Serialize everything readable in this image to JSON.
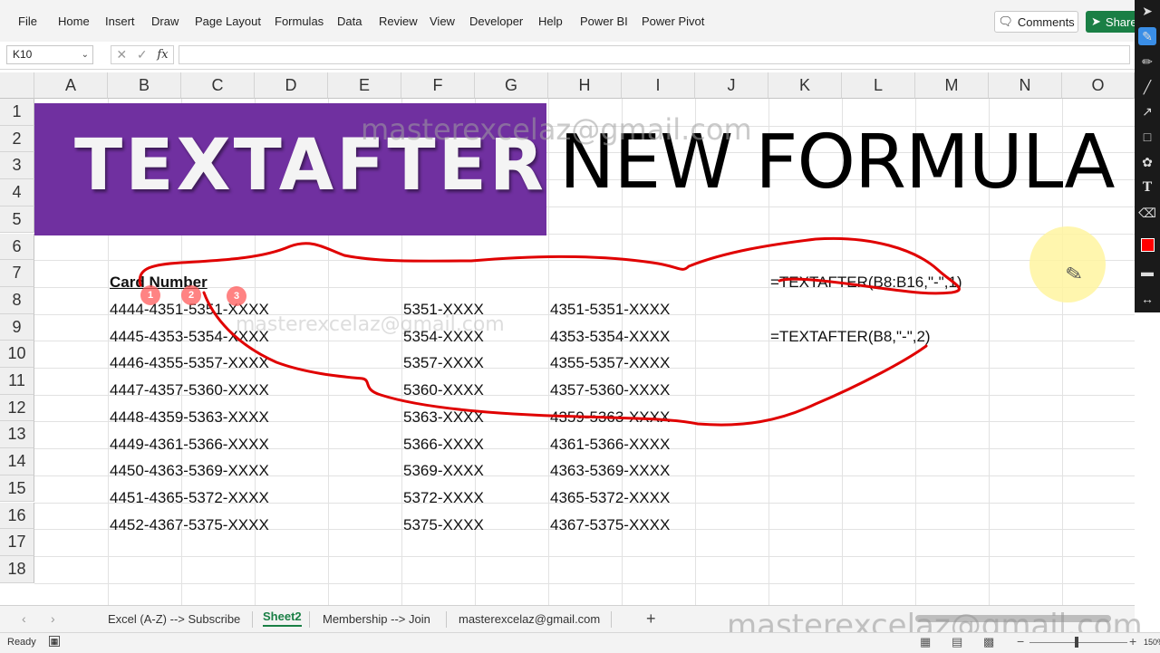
{
  "ribbon": {
    "menus": [
      "File",
      "Home",
      "Insert",
      "Draw",
      "Page Layout",
      "Formulas",
      "Data",
      "Review",
      "View",
      "Developer",
      "Help",
      "Power BI",
      "Power Pivot"
    ],
    "comments_label": "Comments",
    "share_label": "Share"
  },
  "formula_bar": {
    "name_box": "K10",
    "fx_label": "fx",
    "formula": ""
  },
  "grid": {
    "columns": [
      "A",
      "B",
      "C",
      "D",
      "E",
      "F",
      "G",
      "H",
      "I",
      "J",
      "K",
      "L",
      "M",
      "N",
      "O"
    ],
    "rows": [
      "1",
      "2",
      "3",
      "4",
      "5",
      "6",
      "7",
      "8",
      "9",
      "10",
      "11",
      "12",
      "13",
      "14",
      "15",
      "16",
      "17",
      "18"
    ],
    "banner_text": "TEXTAFTER",
    "big_text": "NEW FORMULA",
    "header": "Card Number",
    "card_numbers": [
      "4444-4351-5351-XXXX",
      "4445-4353-5354-XXXX",
      "4446-4355-5357-XXXX",
      "4447-4357-5360-XXXX",
      "4448-4359-5363-XXXX",
      "4449-4361-5366-XXXX",
      "4450-4363-5369-XXXX",
      "4451-4365-5372-XXXX",
      "4452-4367-5375-XXXX"
    ],
    "col_f": [
      "5351-XXXX",
      "5354-XXXX",
      "5357-XXXX",
      "5360-XXXX",
      "5363-XXXX",
      "5366-XXXX",
      "5369-XXXX",
      "5372-XXXX",
      "5375-XXXX"
    ],
    "col_h": [
      "4351-5351-XXXX",
      "4353-5354-XXXX",
      "4355-5357-XXXX",
      "4357-5360-XXXX",
      "4359-5363-XXXX",
      "4361-5366-XXXX",
      "4363-5369-XXXX",
      "4365-5372-XXXX",
      "4367-5375-XXXX"
    ],
    "formula_k7": "=TEXTAFTER(B8:B16,\"-\",1)",
    "formula_k9": "=TEXTAFTER(B8,\"-\",2)",
    "badges": [
      "1",
      "2",
      "3"
    ]
  },
  "watermark": "masterexcelaz@gmail.com",
  "sheet_tabs": {
    "tabs": [
      "Excel (A-Z) --> Subscribe",
      "Sheet2",
      "Membership --> Join",
      "masterexcelaz@gmail.com"
    ],
    "active": "Sheet2",
    "add_label": "+"
  },
  "status_bar": {
    "status": "Ready",
    "zoom": "150%"
  },
  "colors": {
    "banner": "#7030a0",
    "accent_green": "#1a7f45",
    "ink_red": "#e00000"
  }
}
